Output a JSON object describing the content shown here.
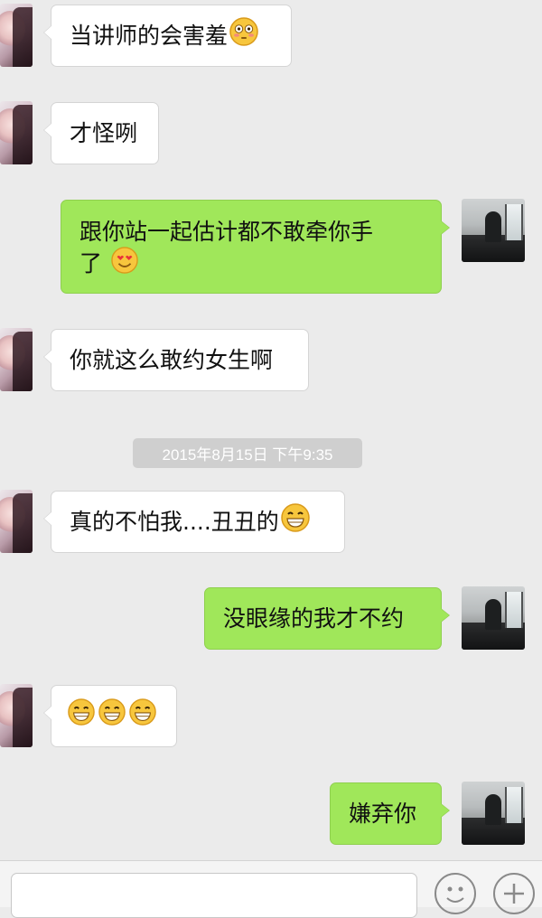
{
  "messages": [
    {
      "side": "in",
      "text": "当讲师的会害羞",
      "emoji": "flushed-face-emoji"
    },
    {
      "side": "in",
      "text": "才怪咧"
    },
    {
      "side": "out",
      "line1": "跟你站一起估计都不敢牵你手",
      "line2": "了",
      "emoji": "heart-eyes-emoji"
    },
    {
      "side": "in",
      "text": "你就这么敢约女生啊"
    },
    {
      "side": "in",
      "text": "真的不怕我....丑丑的",
      "emoji": "grinning-face-emoji"
    },
    {
      "side": "out",
      "text": "没眼缘的我才不约"
    },
    {
      "side": "in",
      "text": "",
      "emoji": "grinning-face-emoji"
    },
    {
      "side": "out",
      "text": "嫌弃你"
    }
  ],
  "timestamp": "2015年8月15日  下午9:35",
  "input": {
    "value": "",
    "placeholder": ""
  },
  "icons": {
    "emoji_button": "smiley-face-icon",
    "plus_button": "plus-icon"
  },
  "colors": {
    "background": "#ebebeb",
    "incoming_bubble": "#ffffff",
    "outgoing_bubble": "#a0e75a",
    "timestamp_pill": "#cfcfcf"
  }
}
